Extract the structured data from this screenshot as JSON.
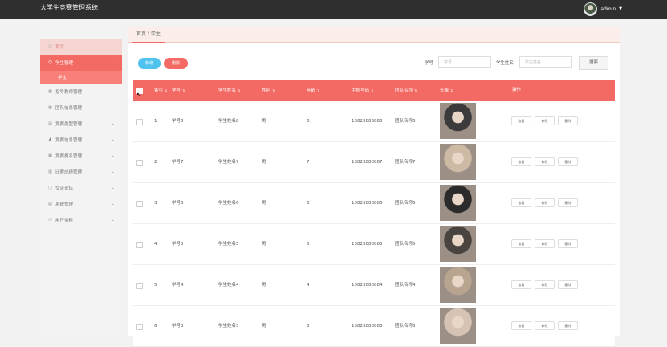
{
  "app": {
    "title": "大学生竞赛管理系统",
    "username": "admin"
  },
  "sidebar": {
    "items": [
      {
        "label": "首页",
        "icon": "home-icon",
        "kind": "home"
      },
      {
        "label": "学生管理",
        "icon": "user-icon",
        "kind": "active-group"
      },
      {
        "label": "学生",
        "kind": "sub-active"
      },
      {
        "label": "指导教师管理",
        "icon": "grid-icon",
        "kind": "group"
      },
      {
        "label": "团队信息管理",
        "icon": "grid-icon",
        "kind": "group"
      },
      {
        "label": "竞赛类型管理",
        "icon": "list-icon",
        "kind": "group"
      },
      {
        "label": "竞赛信息管理",
        "icon": "person-icon",
        "kind": "group"
      },
      {
        "label": "竞赛报名管理",
        "icon": "grid-icon",
        "kind": "group"
      },
      {
        "label": "比赛成绩管理",
        "icon": "chart-icon",
        "kind": "group"
      },
      {
        "label": "交流论坛",
        "icon": "forum-icon",
        "kind": "group"
      },
      {
        "label": "系统管理",
        "icon": "gear-icon",
        "kind": "group"
      },
      {
        "label": "用户资料",
        "icon": "card-icon",
        "kind": "group"
      }
    ]
  },
  "breadcrumb": "首页 / 学生",
  "toolbar": {
    "add_label": "新增",
    "delete_label": "删除",
    "search_label": "搜索",
    "fields": [
      {
        "label": "学号",
        "placeholder": "学号"
      },
      {
        "label": "学生姓名",
        "placeholder": "学生姓名"
      }
    ]
  },
  "table": {
    "headers": [
      "索引",
      "学号",
      "学生姓名",
      "性别",
      "年龄",
      "手机号码",
      "团队名称",
      "头像",
      "操作"
    ],
    "actions": [
      "查看",
      "修改",
      "删除"
    ],
    "rows": [
      {
        "idx": "1",
        "sid": "学号8",
        "name": "学生姓名8",
        "gender": "男",
        "age": "8",
        "phone": "13823888888",
        "team": "团队名称8",
        "photo": "#3c3a3b"
      },
      {
        "idx": "2",
        "sid": "学号7",
        "name": "学生姓名7",
        "gender": "男",
        "age": "7",
        "phone": "13823888887",
        "team": "团队名称7",
        "photo": "#cdb9a4"
      },
      {
        "idx": "3",
        "sid": "学号6",
        "name": "学生姓名6",
        "gender": "男",
        "age": "6",
        "phone": "13823888886",
        "team": "团队名称6",
        "photo": "#2b2b2b"
      },
      {
        "idx": "4",
        "sid": "学号5",
        "name": "学生姓名5",
        "gender": "男",
        "age": "5",
        "phone": "13823888885",
        "team": "团队名称5",
        "photo": "#4a4440"
      },
      {
        "idx": "5",
        "sid": "学号4",
        "name": "学生姓名4",
        "gender": "男",
        "age": "4",
        "phone": "13823888884",
        "team": "团队名称4",
        "photo": "#b9a490"
      },
      {
        "idx": "6",
        "sid": "学号3",
        "name": "学生姓名3",
        "gender": "男",
        "age": "3",
        "phone": "13823888883",
        "team": "团队名称3",
        "photo": "#d7c3b3"
      }
    ]
  },
  "colors": {
    "accent": "#f26a63",
    "topbar": "#2f2f2f",
    "add_button": "#4fc3ee"
  }
}
